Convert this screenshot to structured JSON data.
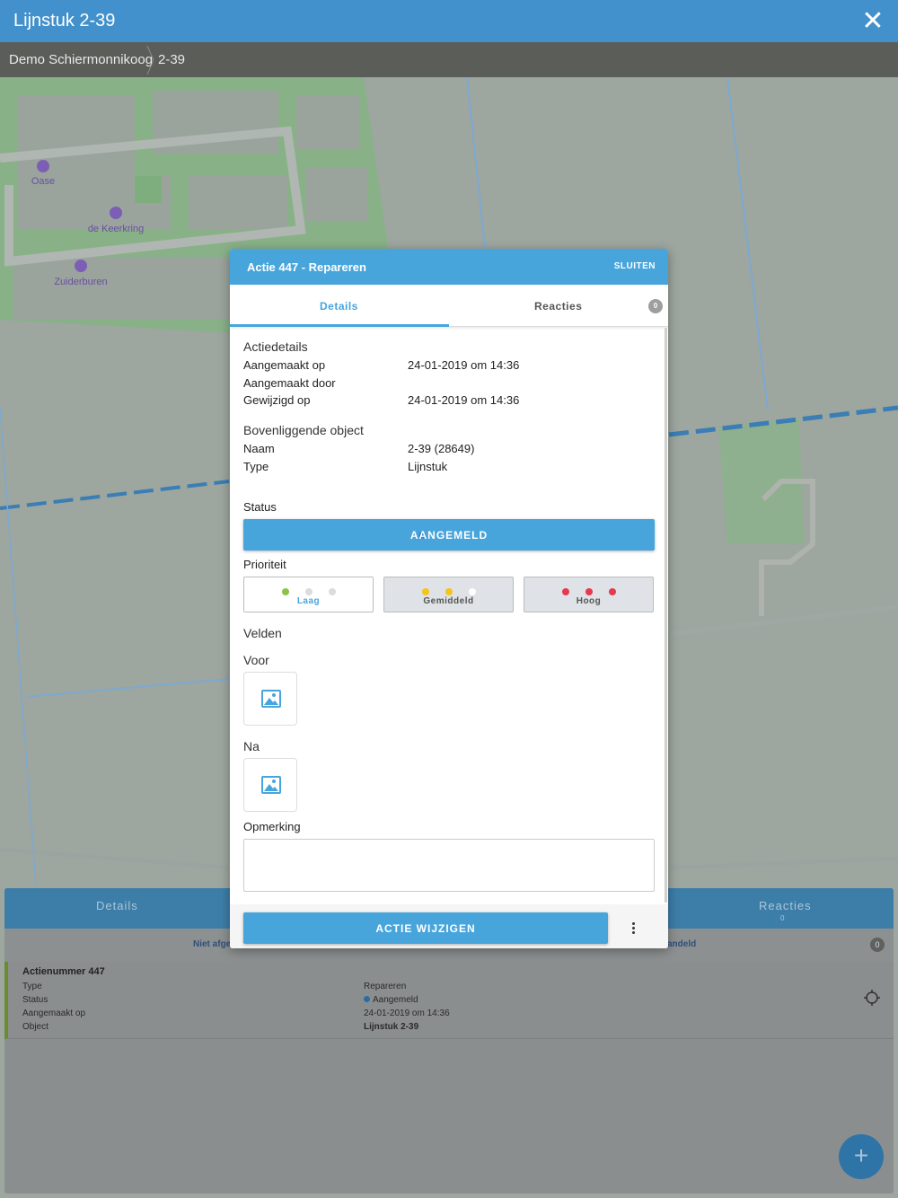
{
  "header": {
    "title": "Lijnstuk 2-39",
    "close_icon": "close-icon"
  },
  "breadcrumb": {
    "items": [
      "Demo Schiermonnikoog",
      "2-39"
    ]
  },
  "map": {
    "labels": [
      "Oase",
      "de Keerkring",
      "Zuiderburen"
    ]
  },
  "bottom_panel": {
    "tabs": [
      {
        "label": "Details"
      },
      {
        "label": "Reacties",
        "count": "0"
      }
    ],
    "filters": [
      "Niet afge",
      "andeld"
    ],
    "filter_badge": "0",
    "item": {
      "title": "Actienummer 447",
      "fields": [
        {
          "label": "Type",
          "value": "Repareren"
        },
        {
          "label": "Status",
          "value": "Aangemeld"
        },
        {
          "label": "Aangemaakt op",
          "value": "24-01-2019 om 14:36"
        },
        {
          "label": "Object",
          "value": "Lijnstuk 2-39"
        }
      ]
    },
    "fab_label": "+"
  },
  "modal": {
    "title": "Actie 447 - Repareren",
    "close_label": "SLUITEN",
    "tabs": [
      {
        "label": "Details",
        "active": true
      },
      {
        "label": "Reacties",
        "badge": "0"
      }
    ],
    "actiedetails": {
      "title": "Actiedetails",
      "rows": [
        {
          "label": "Aangemaakt op",
          "value": "24-01-2019 om 14:36"
        },
        {
          "label": "Aangemaakt door",
          "value": ""
        },
        {
          "label": "Gewijzigd op",
          "value": "24-01-2019 om 14:36"
        }
      ]
    },
    "bovenliggend": {
      "title": "Bovenliggende object",
      "rows": [
        {
          "label": "Naam",
          "value": "2-39 (28649)"
        },
        {
          "label": "Type",
          "value": "Lijnstuk"
        }
      ]
    },
    "status": {
      "label": "Status",
      "value": "AANGEMELD"
    },
    "prioriteit": {
      "label": "Prioriteit",
      "options": [
        {
          "label": "Laag",
          "selected": true
        },
        {
          "label": "Gemiddeld",
          "selected": false
        },
        {
          "label": "Hoog",
          "selected": false
        }
      ]
    },
    "velden": {
      "title": "Velden",
      "voor": "Voor",
      "na": "Na",
      "image_icon": "image-placeholder-icon"
    },
    "opmerking": {
      "label": "Opmerking",
      "value": ""
    },
    "action_button": "ACTIE WIJZIGEN",
    "more_icon": "more-vertical-icon"
  },
  "colors": {
    "primary": "#47a5dc",
    "topbar": "#4291cc",
    "prio_low": "#8bc34a",
    "prio_mid": "#f5c518",
    "prio_high": "#e53950"
  }
}
